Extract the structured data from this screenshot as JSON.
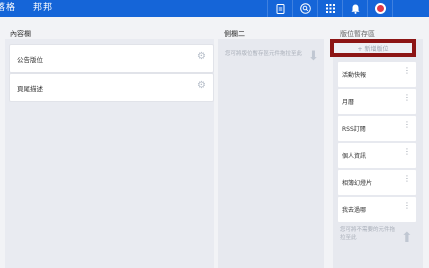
{
  "header": {
    "brand_left": "落格",
    "brand_right": "邦邦",
    "icons": [
      "document-icon",
      "search-circle-icon",
      "grid-icon",
      "bell-icon",
      "avatar"
    ]
  },
  "columns": {
    "content": {
      "title": "內容欄",
      "widgets": [
        {
          "label": "公告版位"
        },
        {
          "label": "頁尾描述"
        }
      ]
    },
    "sidebar2": {
      "title": "側欄二",
      "hint": "您可將版位暫存區元件拖拉至此"
    },
    "storage": {
      "title": "版位暫存區",
      "add_label": "+ 新增版位",
      "items": [
        {
          "label": "活動快報"
        },
        {
          "label": "月曆"
        },
        {
          "label": "RSS訂閱"
        },
        {
          "label": "個人資訊"
        },
        {
          "label": "相簿幻燈片"
        },
        {
          "label": "我去過哪"
        }
      ],
      "hint": "您可將不需要的元件拖拉至此"
    }
  },
  "colors": {
    "topbar": "#1565d8",
    "highlight_border": "#8c1515",
    "avatar": "#e0394a"
  }
}
